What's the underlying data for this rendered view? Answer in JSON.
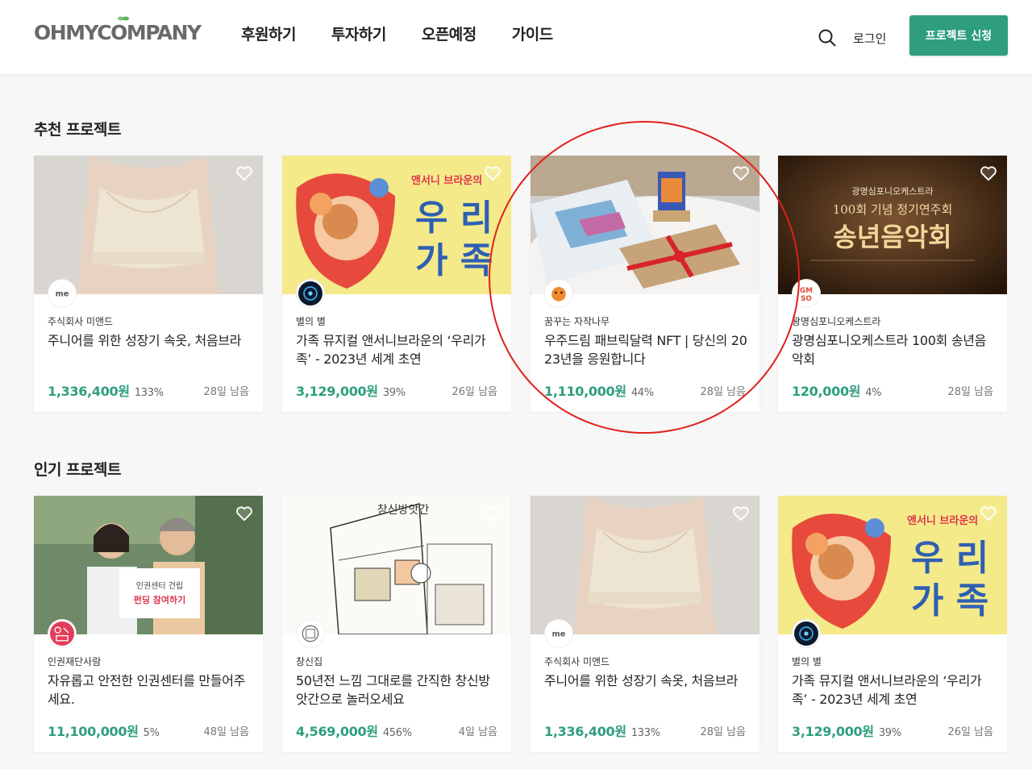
{
  "header": {
    "logo": "OHMYCOMPANY",
    "nav": [
      "후원하기",
      "투자하기",
      "오픈예정",
      "가이드"
    ],
    "login": "로그인",
    "apply": "프로젝트 신청"
  },
  "sections": [
    {
      "title": "추천 프로젝트",
      "cards": [
        {
          "maker": "주식회사 미앤드",
          "title": "주니어를 위한 성장기 속옷, 처음브라",
          "amount": "1,336,400원",
          "percent": "133%",
          "remain": "28일 남음",
          "image": "bra",
          "avatar": "me"
        },
        {
          "maker": "별의 별",
          "title": "가족 뮤지컬 앤서니브라운의 ‘우리가족’ - 2023년 세계 초연",
          "amount": "3,129,000원",
          "percent": "39%",
          "remain": "26일 남음",
          "image": "family",
          "avatar": "star"
        },
        {
          "maker": "꿈꾸는 자작나무",
          "title": "우주드림 패브릭달력 NFT | 당신의 2023년을 응원합니다",
          "amount": "1,110,000원",
          "percent": "44%",
          "remain": "28일 남음",
          "image": "calendar",
          "avatar": "tiger"
        },
        {
          "maker": "광명심포니오케스트라",
          "title": "광명심포니오케스트라 100회 송년음악회",
          "amount": "120,000원",
          "percent": "4%",
          "remain": "28일 남음",
          "image": "concert",
          "avatar": "gmso"
        }
      ]
    },
    {
      "title": "인기 프로젝트",
      "cards": [
        {
          "maker": "인권재단사람",
          "title": "자유롭고 안전한 인권센터를 만들어주세요.",
          "amount": "11,100,000원",
          "percent": "5%",
          "remain": "48일 남음",
          "image": "people",
          "avatar": "human"
        },
        {
          "maker": "창신집",
          "title": "50년전 느낌 그대로를 간직한 창신방앗간으로 놀러오세요",
          "amount": "4,569,000원",
          "percent": "456%",
          "remain": "4일 남음",
          "image": "sketch",
          "avatar": "shop"
        },
        {
          "maker": "주식회사 미앤드",
          "title": "주니어를 위한 성장기 속옷, 처음브라",
          "amount": "1,336,400원",
          "percent": "133%",
          "remain": "28일 남음",
          "image": "bra",
          "avatar": "me"
        },
        {
          "maker": "별의 별",
          "title": "가족 뮤지컬 앤서니브라운의 ‘우리가족’ - 2023년 세계 초연",
          "amount": "3,129,000원",
          "percent": "39%",
          "remain": "26일 남음",
          "image": "family",
          "avatar": "star"
        }
      ]
    }
  ],
  "image_text": {
    "family_top": "앤서니 브라운의",
    "family_main1": "우 리",
    "family_main2": "가 족",
    "concert_org": "광명심포니오케스트라",
    "concert_sub": "100회 기념 정기연주회",
    "concert_main": "송년음악회",
    "people_sign1": "인권센터 건립",
    "people_sign2": "펀딩 참여하기",
    "sketch_title": "창신방앗간"
  },
  "colors": {
    "accent": "#2e9e7f",
    "highlight_circle": "#e0201c"
  }
}
